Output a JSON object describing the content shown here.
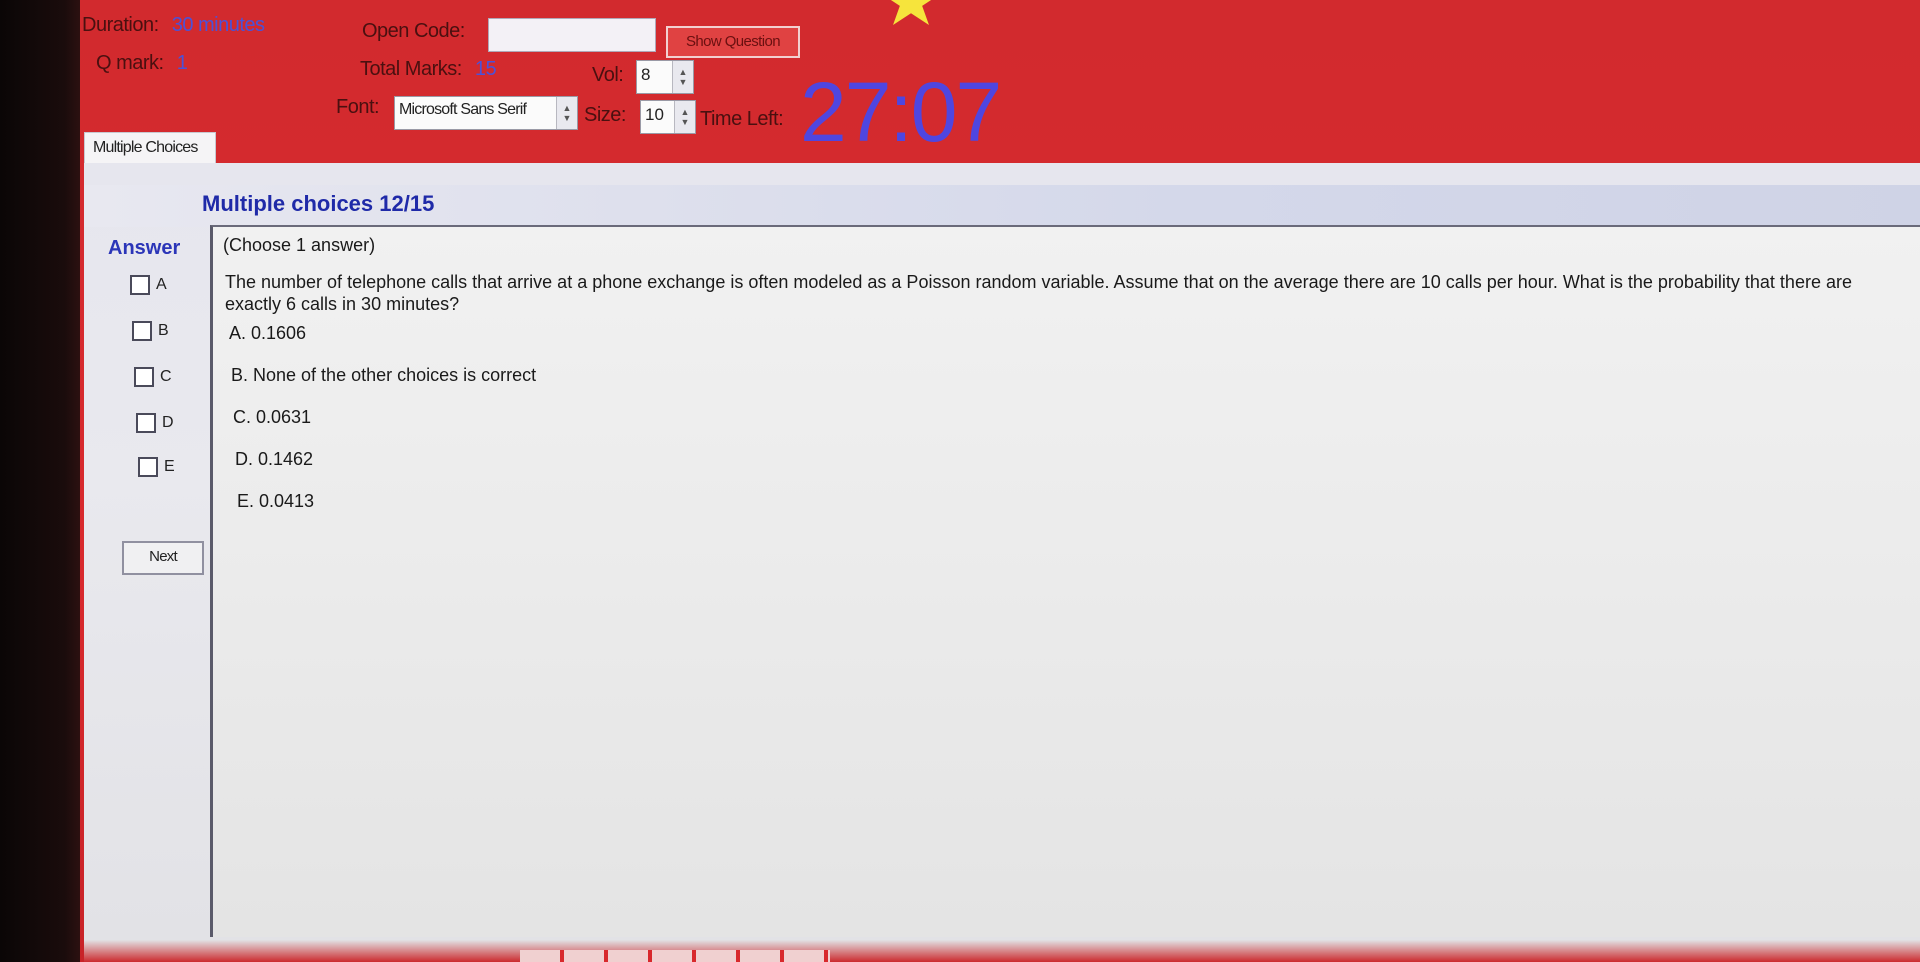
{
  "header": {
    "duration_label": "Duration:",
    "duration_value": "30 minutes",
    "qmark_label": "Q mark:",
    "qmark_value": "1",
    "open_code_label": "Open Code:",
    "open_code_value": "",
    "show_question_label": "Show Question",
    "total_marks_label": "Total Marks:",
    "total_marks_value": "15",
    "vol_label": "Vol:",
    "vol_value": "8",
    "font_label": "Font:",
    "font_value": "Microsoft Sans Serif",
    "size_label": "Size:",
    "size_value": "10",
    "time_left_label": "Time Left:",
    "time_left_value": "27:07"
  },
  "tab": {
    "label": "Multiple Choices"
  },
  "section": {
    "title": "Multiple choices 12/15"
  },
  "answer": {
    "label": "Answer",
    "options": [
      "A",
      "B",
      "C",
      "D",
      "E"
    ],
    "next_label": "Next"
  },
  "question": {
    "instruction": "(Choose 1 answer)",
    "text": "The number of telephone calls that arrive at a phone exchange is often modeled as a Poisson random variable. Assume that on the average there are 10 calls per hour. What is the probability that there are exactly 6 calls in 30 minutes?",
    "choices": [
      "A. 0.1606",
      "B. None of the other choices is correct",
      "C. 0.0631",
      "D. 0.1462",
      "E. 0.0413"
    ]
  },
  "colors": {
    "background": "#d8282c",
    "accent_blue": "#4b52d8",
    "panel": "#e9e9ee"
  },
  "icons": {
    "star": "star-icon",
    "spinner": "spinner-arrows-icon"
  }
}
